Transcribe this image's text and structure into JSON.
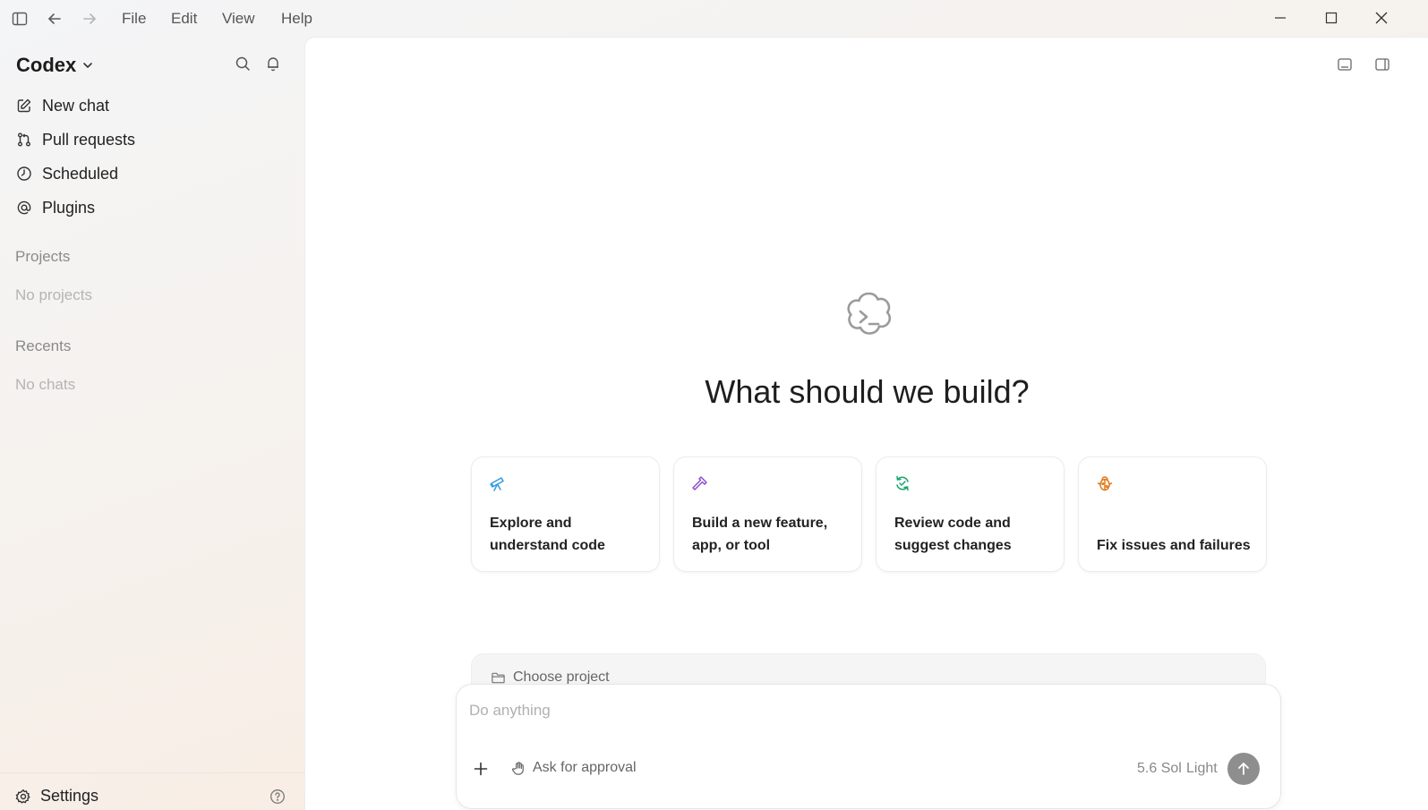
{
  "menu": {
    "file": "File",
    "edit": "Edit",
    "view": "View",
    "help": "Help"
  },
  "sidebar": {
    "brand": "Codex",
    "nav": [
      {
        "label": "New chat",
        "icon": "edit-icon"
      },
      {
        "label": "Pull requests",
        "icon": "git-pull-request-icon"
      },
      {
        "label": "Scheduled",
        "icon": "clock-icon"
      },
      {
        "label": "Plugins",
        "icon": "at-sign-icon"
      }
    ],
    "projects_title": "Projects",
    "projects_empty": "No projects",
    "recents_title": "Recents",
    "recents_empty": "No chats",
    "settings_label": "Settings"
  },
  "main": {
    "headline": "What should we build?",
    "cards": [
      {
        "label": "Explore and understand code",
        "icon": "telescope-icon",
        "color": "#2f9be0"
      },
      {
        "label": "Build a new feature, app, or tool",
        "icon": "hammer-icon",
        "color": "#8a4fd0"
      },
      {
        "label": "Review code and suggest changes",
        "icon": "refresh-check-icon",
        "color": "#1aa56a"
      },
      {
        "label": "Fix issues and failures",
        "icon": "bug-icon",
        "color": "#e07a1f"
      }
    ],
    "project_picker": "Choose project",
    "composer": {
      "placeholder": "Do anything",
      "approval": "Ask for approval",
      "model": "5.6 Sol",
      "effort": "Light"
    }
  }
}
